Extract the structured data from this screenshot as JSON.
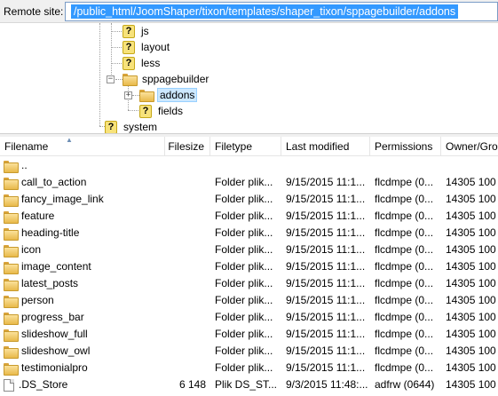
{
  "remote": {
    "label": "Remote site:",
    "path": "/public_html/JoomShaper/tixon/templates/shaper_tixon/sppagebuilder/addons"
  },
  "tree": {
    "nodes": [
      {
        "label": "js",
        "icon": "question-icon"
      },
      {
        "label": "layout",
        "icon": "question-icon"
      },
      {
        "label": "less",
        "icon": "question-icon"
      },
      {
        "label": "sppagebuilder",
        "icon": "folder-icon",
        "expander": "−"
      },
      {
        "label": "addons",
        "icon": "folder-icon",
        "expander": "+"
      },
      {
        "label": "fields",
        "icon": "question-icon"
      },
      {
        "label": "system",
        "icon": "question-icon"
      }
    ]
  },
  "list": {
    "columns": {
      "filename": "Filename",
      "filesize": "Filesize",
      "filetype": "Filetype",
      "modified": "Last modified",
      "permissions": "Permissions",
      "owner": "Owner/Gro"
    },
    "rows": [
      {
        "name": "..",
        "size": "",
        "type": "",
        "modified": "",
        "permissions": "",
        "owner": "",
        "icon": "folder-icon"
      },
      {
        "name": "call_to_action",
        "size": "",
        "type": "Folder plik...",
        "modified": "9/15/2015 11:1...",
        "permissions": "flcdmpe (0...",
        "owner": "14305 100",
        "icon": "folder-icon"
      },
      {
        "name": "fancy_image_link",
        "size": "",
        "type": "Folder plik...",
        "modified": "9/15/2015 11:1...",
        "permissions": "flcdmpe (0...",
        "owner": "14305 100",
        "icon": "folder-icon"
      },
      {
        "name": "feature",
        "size": "",
        "type": "Folder plik...",
        "modified": "9/15/2015 11:1...",
        "permissions": "flcdmpe (0...",
        "owner": "14305 100",
        "icon": "folder-icon"
      },
      {
        "name": "heading-title",
        "size": "",
        "type": "Folder plik...",
        "modified": "9/15/2015 11:1...",
        "permissions": "flcdmpe (0...",
        "owner": "14305 100",
        "icon": "folder-icon"
      },
      {
        "name": "icon",
        "size": "",
        "type": "Folder plik...",
        "modified": "9/15/2015 11:1...",
        "permissions": "flcdmpe (0...",
        "owner": "14305 100",
        "icon": "folder-icon"
      },
      {
        "name": "image_content",
        "size": "",
        "type": "Folder plik...",
        "modified": "9/15/2015 11:1...",
        "permissions": "flcdmpe (0...",
        "owner": "14305 100",
        "icon": "folder-icon"
      },
      {
        "name": "latest_posts",
        "size": "",
        "type": "Folder plik...",
        "modified": "9/15/2015 11:1...",
        "permissions": "flcdmpe (0...",
        "owner": "14305 100",
        "icon": "folder-icon"
      },
      {
        "name": "person",
        "size": "",
        "type": "Folder plik...",
        "modified": "9/15/2015 11:1...",
        "permissions": "flcdmpe (0...",
        "owner": "14305 100",
        "icon": "folder-icon"
      },
      {
        "name": "progress_bar",
        "size": "",
        "type": "Folder plik...",
        "modified": "9/15/2015 11:1...",
        "permissions": "flcdmpe (0...",
        "owner": "14305 100",
        "icon": "folder-icon"
      },
      {
        "name": "slideshow_full",
        "size": "",
        "type": "Folder plik...",
        "modified": "9/15/2015 11:1...",
        "permissions": "flcdmpe (0...",
        "owner": "14305 100",
        "icon": "folder-icon"
      },
      {
        "name": "slideshow_owl",
        "size": "",
        "type": "Folder plik...",
        "modified": "9/15/2015 11:1...",
        "permissions": "flcdmpe (0...",
        "owner": "14305 100",
        "icon": "folder-icon"
      },
      {
        "name": "testimonialpro",
        "size": "",
        "type": "Folder plik...",
        "modified": "9/15/2015 11:1...",
        "permissions": "flcdmpe (0...",
        "owner": "14305 100",
        "icon": "folder-icon"
      },
      {
        "name": ".DS_Store",
        "size": "6 148",
        "type": "Plik DS_ST...",
        "modified": "9/3/2015 11:48:...",
        "permissions": "adfrw (0644)",
        "owner": "14305 100",
        "icon": "file-icon"
      }
    ]
  },
  "colors": {
    "selection": "#3399ff",
    "tree_selected": "#cce8ff",
    "folder": "#e8b94a"
  }
}
